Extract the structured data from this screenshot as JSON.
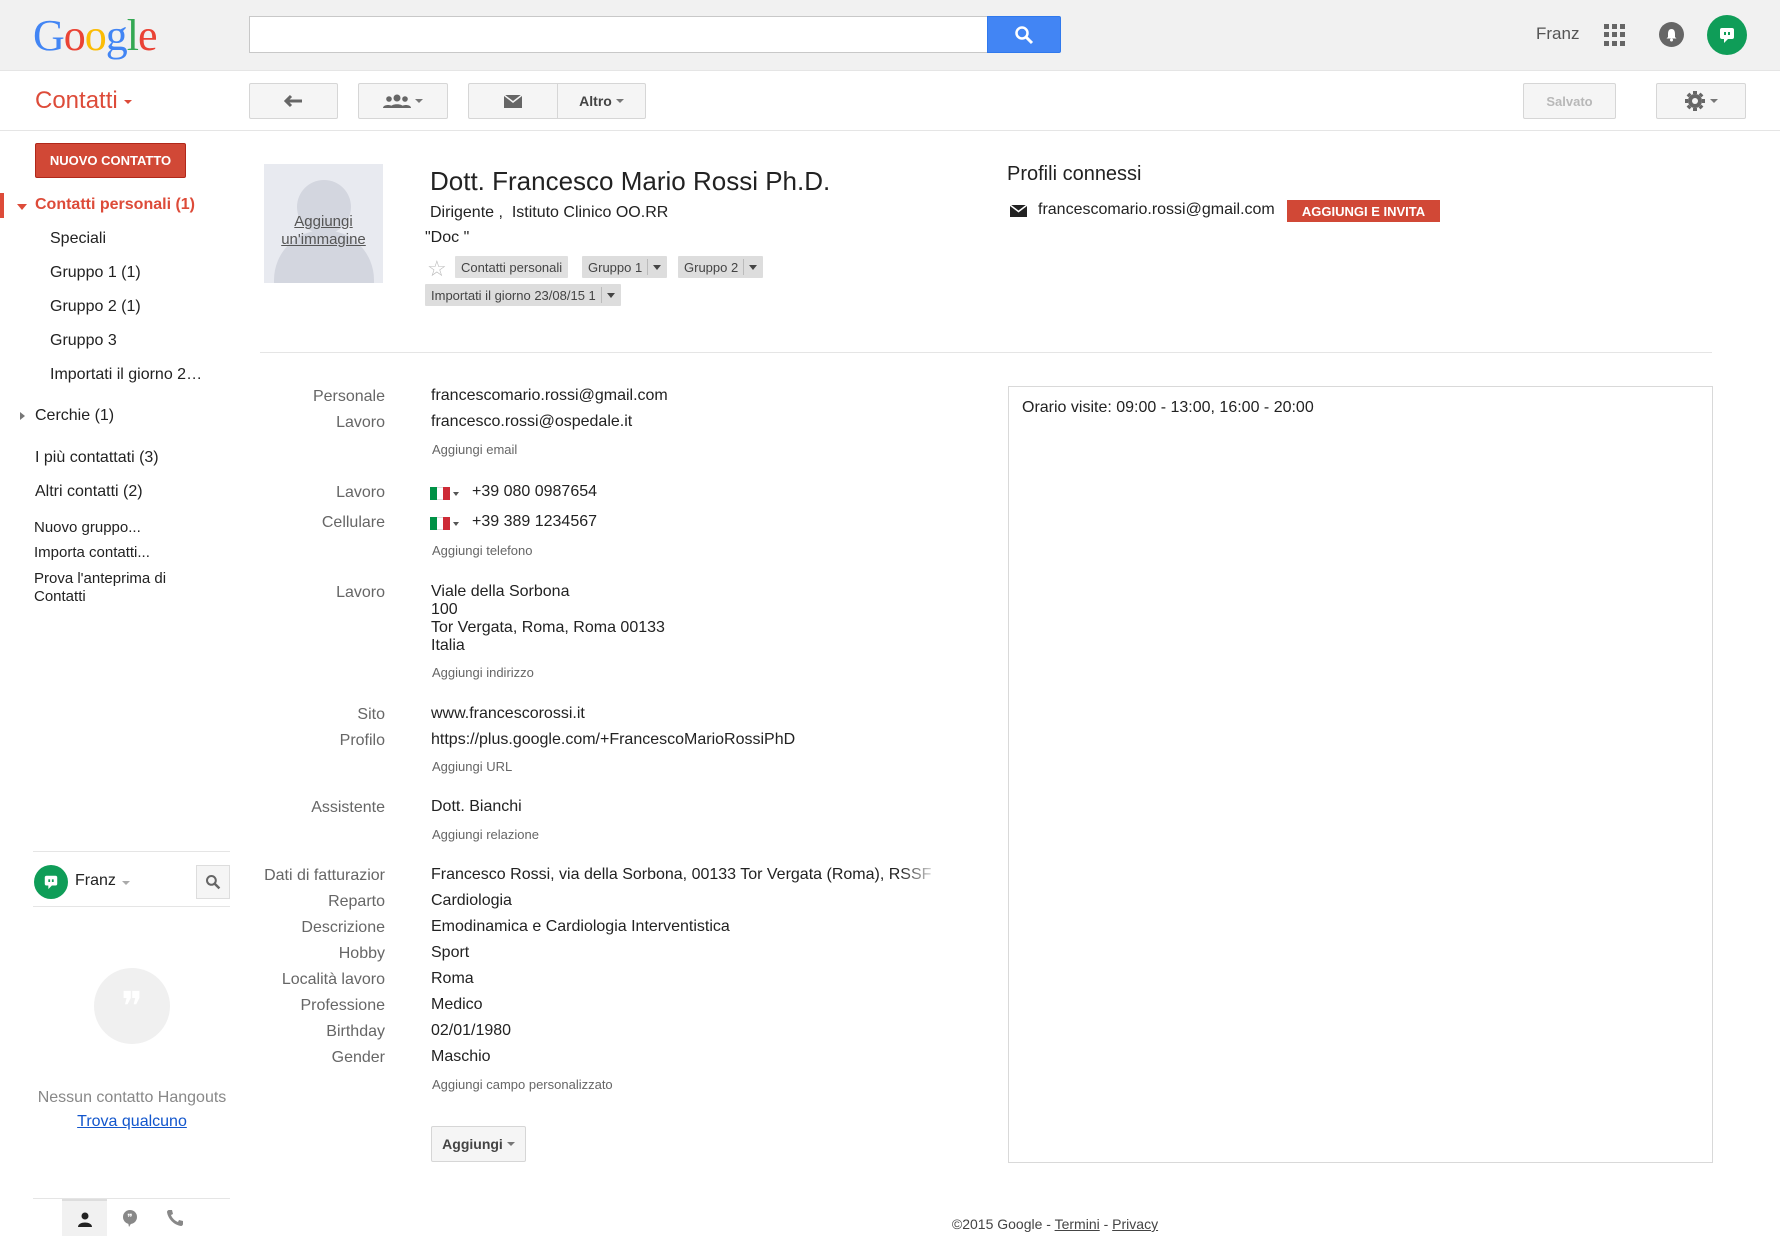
{
  "colors": {
    "accent_red": "#dd4b39",
    "button_red": "#d14836",
    "search_blue": "#4285f4",
    "hangouts_green": "#0f9d58"
  },
  "header": {
    "logo_letters": [
      {
        "ch": "G",
        "color": "#4285f4"
      },
      {
        "ch": "o",
        "color": "#ea4335"
      },
      {
        "ch": "o",
        "color": "#fbbc05"
      },
      {
        "ch": "g",
        "color": "#4285f4"
      },
      {
        "ch": "l",
        "color": "#34a853"
      },
      {
        "ch": "e",
        "color": "#ea4335"
      }
    ],
    "search_placeholder": "",
    "search_icon": "search-icon",
    "user_name": "Franz",
    "apps_icon": "apps-grid-icon",
    "notifications_icon": "bell-icon",
    "hangouts_icon": "hangouts-icon"
  },
  "toolbar": {
    "app_title": "Contatti",
    "back_icon": "back-arrow-icon",
    "groups_icon": "people-icon",
    "mail_icon": "mail-icon",
    "more_label": "Altro",
    "saved_label": "Salvato",
    "settings_icon": "gear-icon"
  },
  "sidebar": {
    "new_contact_label": "NUOVO CONTATTO",
    "personal_contacts": "Contatti personali (1)",
    "groups": [
      "Speciali",
      "Gruppo 1 (1)",
      "Gruppo 2 (1)",
      "Gruppo 3",
      "Importati il giorno 2…"
    ],
    "circles": "Cerchie (1)",
    "most_contacted": "I più contattati (3)",
    "other_contacts": "Altri contatti (2)",
    "new_group": "Nuovo gruppo...",
    "import_contacts": "Importa contatti...",
    "preview_line1": "Prova l'anteprima di",
    "preview_line2": "Contatti"
  },
  "hangouts": {
    "user": "Franz",
    "empty_text": "Nessun contatto Hangouts",
    "find_link": "Trova qualcuno",
    "tab_icons": [
      "person-icon",
      "quote-bubble-icon",
      "phone-icon"
    ]
  },
  "contact": {
    "photo_label_line1": "Aggiungi",
    "photo_label_line2": "un'immagine",
    "name": "Dott. Francesco Mario Rossi Ph.D.",
    "job_title": "Dirigente ,",
    "company": "Istituto Clinico OO.RR",
    "nickname": "\"Doc     \"",
    "groups_chips": [
      "Contatti personali",
      "Gruppo 1",
      "Gruppo 2"
    ],
    "import_chip": "Importati il giorno 23/08/15 1"
  },
  "profiles": {
    "title": "Profili connessi",
    "email": "francescomario.rossi@gmail.com",
    "invite_label": "AGGIUNGI E INVITA"
  },
  "fields": {
    "emails": [
      {
        "label": "Personale",
        "value": "francescomario.rossi@gmail.com"
      },
      {
        "label": "Lavoro",
        "value": "francesco.rossi@ospedale.it"
      }
    ],
    "add_email": "Aggiungi email",
    "phones": [
      {
        "label": "Lavoro",
        "value": "+39 080 0987654"
      },
      {
        "label": "Cellulare",
        "value": "+39 389 1234567"
      }
    ],
    "add_phone": "Aggiungi telefono",
    "address_label": "Lavoro",
    "address_lines": [
      "Viale della Sorbona",
      "100",
      "Tor Vergata, Roma, Roma 00133",
      "Italia"
    ],
    "add_address": "Aggiungi indirizzo",
    "urls": [
      {
        "label": "Sito",
        "value": "www.francescorossi.it"
      },
      {
        "label": "Profilo",
        "value": "https://plus.google.com/+FrancescoMarioRossiPhD"
      }
    ],
    "add_url": "Aggiungi URL",
    "relation": {
      "label": "Assistente",
      "value": "Dott. Bianchi"
    },
    "add_relation": "Aggiungi relazione",
    "custom": [
      {
        "label": "Dati di fatturazior",
        "value": "Francesco Rossi, via della Sorbona, 00133 Tor Vergata (Roma), RSSF"
      },
      {
        "label": "Reparto",
        "value": "Cardiologia"
      },
      {
        "label": "Descrizione",
        "value": "Emodinamica e Cardiologia Interventistica"
      },
      {
        "label": "Hobby",
        "value": "Sport"
      },
      {
        "label": "Località lavoro",
        "value": "Roma"
      },
      {
        "label": "Professione",
        "value": "Medico"
      },
      {
        "label": "Birthday",
        "value": "02/01/1980"
      },
      {
        "label": "Gender",
        "value": "Maschio"
      }
    ],
    "add_custom": "Aggiungi campo personalizzato",
    "add_button": "Aggiungi"
  },
  "notes": "Orario visite: 09:00 - 13:00, 16:00 - 20:00",
  "footer": {
    "copyright": "©2015 Google - ",
    "terms": "Termini",
    "sep": " - ",
    "privacy": "Privacy"
  }
}
